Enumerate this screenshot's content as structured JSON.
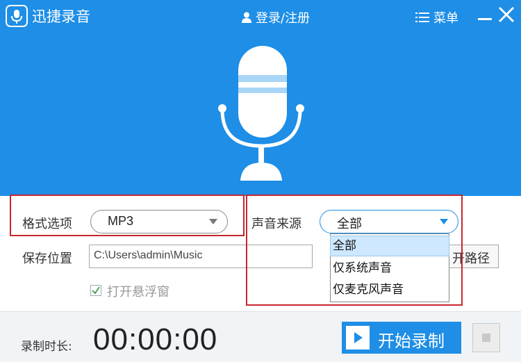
{
  "app": {
    "title": "迅捷录音",
    "login_label": "登录/注册",
    "menu_label": "菜单"
  },
  "icons": {
    "logo": "microphone-icon",
    "user": "user-icon",
    "menu": "menu-icon",
    "minimize": "minimize-icon",
    "close": "close-icon",
    "mic_large": "microphone-icon",
    "play": "play-icon",
    "stop": "stop-icon",
    "dropdown": "chevron-down-icon",
    "checkbox": "check-icon"
  },
  "form": {
    "format_label": "格式选项",
    "format_value": "MP3",
    "source_label": "声音来源",
    "source_value": "全部",
    "source_options": [
      "全部",
      "仅系统声音",
      "仅麦克风声音"
    ],
    "save_label": "保存位置",
    "save_path": "C:\\Users\\admin\\Music",
    "open_path_label": "开路径",
    "float_window_label": "打开悬浮窗",
    "float_window_checked": true
  },
  "footer": {
    "duration_label": "录制时长:",
    "duration_value": "00:00:00",
    "start_label": "开始录制"
  },
  "colors": {
    "primary": "#1e8ee6",
    "highlight_box": "#c8262e",
    "selected_option": "#cde8ff"
  }
}
